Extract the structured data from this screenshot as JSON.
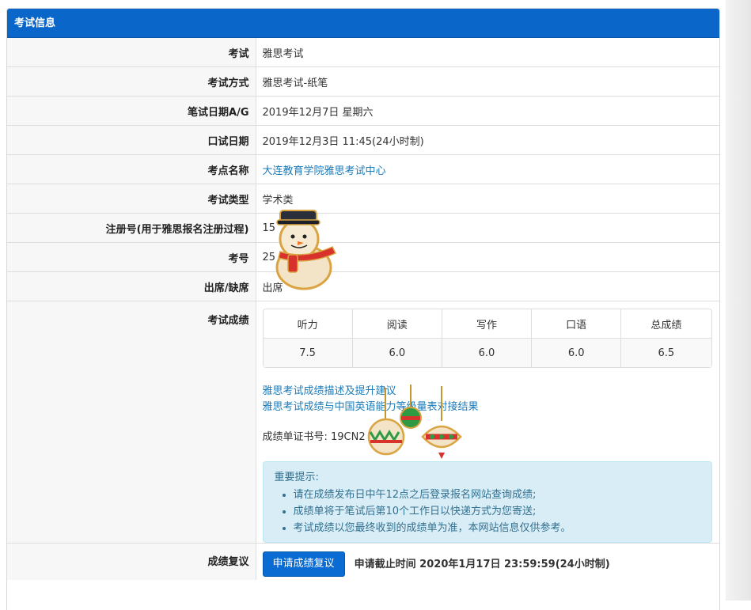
{
  "panel": {
    "title": "考试信息"
  },
  "rows": [
    {
      "label": "考试",
      "value": "雅思考试"
    },
    {
      "label": "考试方式",
      "value": "雅思考试-纸笔"
    },
    {
      "label": "笔试日期A/G",
      "value": "2019年12月7日 星期六"
    },
    {
      "label": "口试日期",
      "value": "2019年12月3日 11:45(24小时制)"
    },
    {
      "label": "考点名称",
      "value": "大连教育学院雅思考试中心"
    },
    {
      "label": "考试类型",
      "value": "学术类"
    },
    {
      "label": "注册号(用于雅思报名注册过程)",
      "value": "15"
    },
    {
      "label": "考号",
      "value": "25"
    },
    {
      "label": "出席/缺席",
      "value": "出席"
    }
  ],
  "scores": {
    "label": "考试成绩",
    "headers": [
      "听力",
      "阅读",
      "写作",
      "口语",
      "总成绩"
    ],
    "values": [
      "7.5",
      "6.0",
      "6.0",
      "6.0",
      "6.5"
    ],
    "links": [
      "雅思考试成绩描述及提升建议",
      "雅思考试成绩与中国英语能力等级量表对接结果"
    ],
    "certificate": "成绩单证书号: 19CN2     MU"
  },
  "notice": {
    "title": "重要提示:",
    "items": [
      "请在成绩发布日中午12点之后登录报名网站查询成绩;",
      "成绩单将于笔试后第10个工作日以快递方式为您寄送;",
      "考试成绩以您最终收到的成绩单为准，本网站信息仅供参考。"
    ]
  },
  "review": {
    "label": "成绩复议",
    "button": "申请成绩复议",
    "deadline": "申请截止时间 2020年1月17日 23:59:59(24小时制)"
  },
  "colors": {
    "heading": "#0a66c8",
    "link": "#1a7bb9",
    "notice_bg": "#d9edf7",
    "notice_text": "#31708f"
  },
  "decorations": [
    "snowman-sticker",
    "christmas-ornament-icons"
  ]
}
